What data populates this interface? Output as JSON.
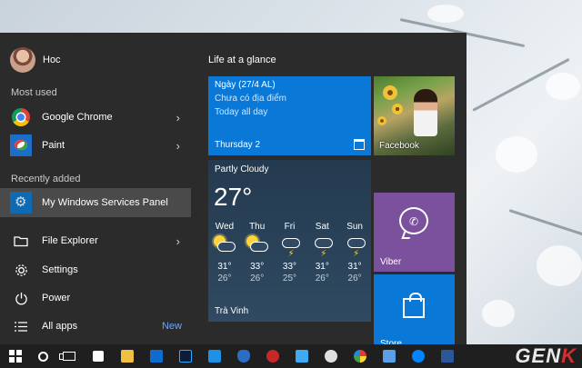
{
  "user": {
    "name": "Hoc"
  },
  "left": {
    "most_used_label": "Most used",
    "most_used": [
      {
        "label": "Google Chrome",
        "icon": "chrome-icon",
        "has_submenu": true
      },
      {
        "label": "Paint",
        "icon": "paint-icon",
        "has_submenu": true
      }
    ],
    "recently_added_label": "Recently added",
    "recently_added": [
      {
        "label": "My Windows Services Panel",
        "icon": "services-icon",
        "selected": true
      }
    ],
    "bottom": [
      {
        "label": "File Explorer",
        "icon": "folder-icon",
        "has_submenu": true
      },
      {
        "label": "Settings",
        "icon": "gear-icon"
      },
      {
        "label": "Power",
        "icon": "power-icon"
      },
      {
        "label": "All apps",
        "icon": "list-icon",
        "badge": "New"
      }
    ]
  },
  "tiles": {
    "group_title": "Life at a glance",
    "calendar": {
      "line1": "Ngày (27/4 AL)",
      "line2": "Chưa có địa điểm",
      "line3": "Today all day",
      "date": "Thursday 2"
    },
    "facebook": {
      "label": "Facebook"
    },
    "weather": {
      "condition": "Partly Cloudy",
      "temperature": "27°",
      "location": "Trà Vinh",
      "forecast": [
        {
          "day": "Wed",
          "icon": "partly-sunny-icon",
          "high": "31°",
          "low": "26°"
        },
        {
          "day": "Thu",
          "icon": "partly-sunny-icon",
          "high": "33°",
          "low": "26°"
        },
        {
          "day": "Fri",
          "icon": "thunderstorm-icon",
          "high": "33°",
          "low": "25°"
        },
        {
          "day": "Sat",
          "icon": "thunderstorm-icon",
          "high": "31°",
          "low": "26°"
        },
        {
          "day": "Sun",
          "icon": "thunderstorm-icon",
          "high": "31°",
          "low": "26°"
        }
      ]
    },
    "viber": {
      "label": "Viber"
    },
    "store": {
      "label": "Store"
    }
  },
  "colors": {
    "menu_bg": "#2b2b2b",
    "accent": "#0a78d6",
    "viber": "#7b519d",
    "taskbar": "#1f1f1f"
  },
  "watermark": {
    "text_main": "GEN",
    "text_accent": "K"
  }
}
